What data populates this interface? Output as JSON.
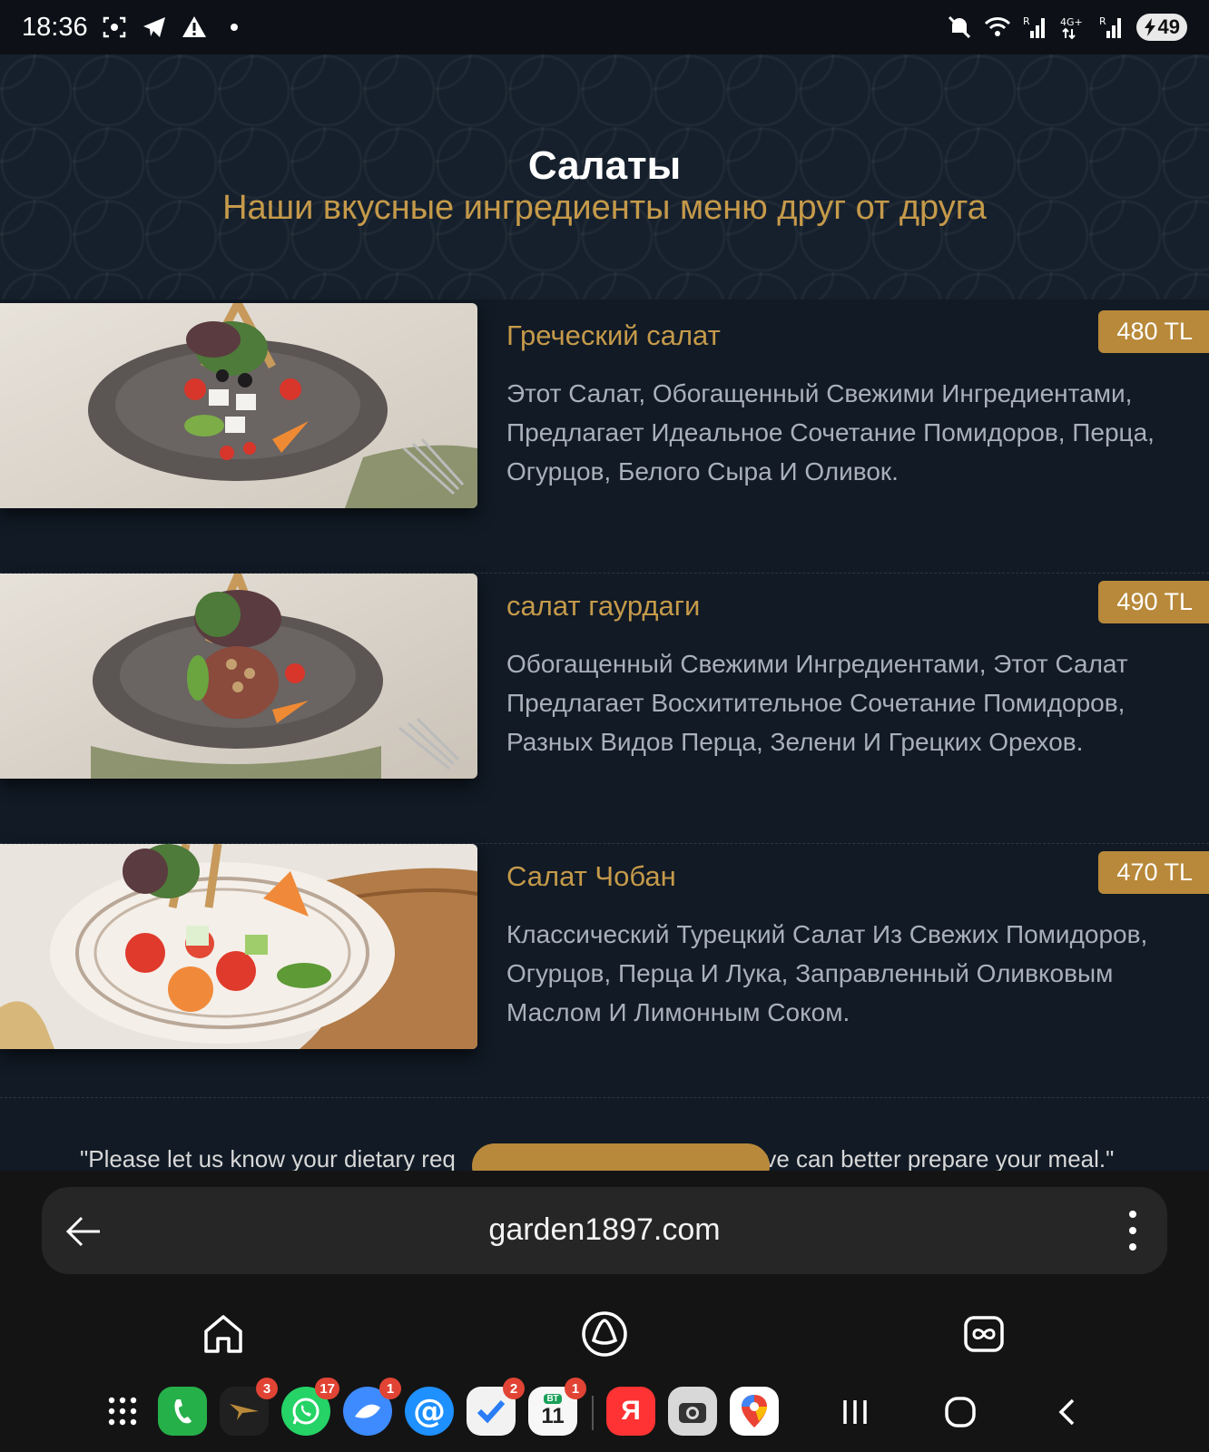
{
  "status_bar": {
    "time": "18:36",
    "left_icons": [
      "screenshot-icon",
      "telegram-icon",
      "warning-icon",
      "dot-icon"
    ],
    "right_icons": [
      "mute-icon",
      "wifi-icon",
      "signal-r-icon",
      "4g-signal-icon",
      "signal-r2-icon"
    ],
    "battery": "49"
  },
  "hero": {
    "title": "Салаты",
    "subtitle": "Наши вкусные ингредиенты меню друг от друга"
  },
  "menu_items": [
    {
      "name": "Греческий салат",
      "price": "480 TL",
      "description": "Этот Салат, Обогащенный Свежими Ингредиентами, Предлагает Идеальное Сочетание Помидоров, Перца, Огурцов, Белого Сыра И Оливок."
    },
    {
      "name": "салат гаурдаги",
      "price": "490 TL",
      "description": "Обогащенный Свежими Ингредиентами, Этот Салат Предлагает Восхитительное Сочетание Помидоров, Разных Видов Перца, Зелени И Грецких Орехов."
    },
    {
      "name": "Салат Чобан",
      "price": "470 TL",
      "description": "Классический Турецкий Салат Из Свежих Помидоров, Огурцов, Перца И Лука, Заправленный Оливковым Маслом И Лимонным Соком."
    }
  ],
  "footer_note": {
    "left": "\"Please let us know your dietary req",
    "right": "ve can better prepare your meal.\""
  },
  "browser": {
    "url": "garden1897.com"
  },
  "dock": {
    "apps": [
      {
        "name": "apps-grid-icon",
        "badge": ""
      },
      {
        "name": "phone-icon",
        "badge": ""
      },
      {
        "name": "bird-app-icon",
        "badge": "3"
      },
      {
        "name": "whatsapp-icon",
        "badge": "17"
      },
      {
        "name": "blue-app-icon",
        "badge": "1"
      },
      {
        "name": "mail-icon",
        "badge": ""
      },
      {
        "name": "tasks-icon",
        "badge": "2"
      },
      {
        "name": "calendar-icon",
        "badge": "1"
      },
      {
        "name": "yandex-icon",
        "badge": ""
      },
      {
        "name": "camera-icon",
        "badge": ""
      },
      {
        "name": "maps-icon",
        "badge": ""
      }
    ],
    "calendar_day": "11",
    "calendar_weekday": "ВТ",
    "yandex_letter": "Я"
  },
  "colors": {
    "accent_gold": "#c59a4a",
    "price_badge": "#b8893a",
    "page_bg": "#111a25",
    "description_text": "#a9b0ba"
  }
}
